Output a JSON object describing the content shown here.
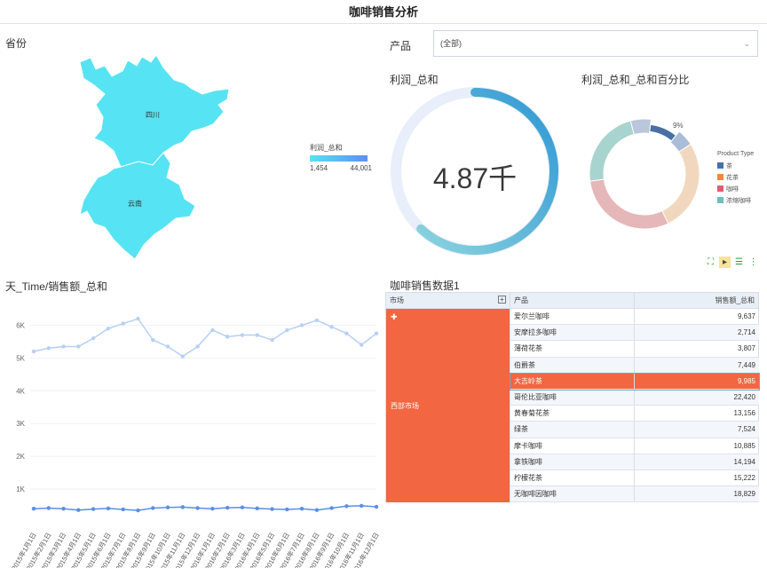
{
  "page": {
    "title": "咖啡销售分析"
  },
  "map": {
    "title": "省份",
    "regions": [
      "四川",
      "云南"
    ],
    "legend_title": "利润_总和",
    "legend_min": "1,454",
    "legend_max": "44,001",
    "colors": {
      "fill": "#56e3f3",
      "low": "#5ae1f2",
      "high": "#5f8ff0"
    }
  },
  "filter": {
    "label": "产品",
    "value": "(全部)"
  },
  "gauge": {
    "title": "利润_总和",
    "value": "4.87千",
    "fraction": 0.62,
    "colors": {
      "track": "#e8eefa",
      "arc_start": "#8bd3df",
      "arc_end": "#2f97d3"
    }
  },
  "donut": {
    "title": "利润_总和_总和百分比",
    "legend_title": "Product Type",
    "label": "9%",
    "items": [
      {
        "name": "茶",
        "color": "#4a6fa5"
      },
      {
        "name": "花茶",
        "color": "#f0883b"
      },
      {
        "name": "咖啡",
        "color": "#e05d6f"
      },
      {
        "name": "浓缩咖啡",
        "color": "#6dbfb7"
      }
    ]
  },
  "toolbar": {
    "icons": [
      "expand-icon",
      "select-icon",
      "list-icon",
      "more-icon"
    ]
  },
  "line_chart": {
    "title": "天_Time/销售额_总和"
  },
  "chart_data": {
    "type": "line",
    "title": "天_Time/销售额_总和",
    "x": [
      "2015年1月1日",
      "2015年2月1日",
      "2015年3月1日",
      "2015年4月1日",
      "2015年5月1日",
      "2015年6月1日",
      "2015年7月1日",
      "2015年8月1日",
      "2015年9月1日",
      "2015年10月1日",
      "2015年11月1日",
      "2015年12月1日",
      "2016年1月1日",
      "2016年2月1日",
      "2016年3月1日",
      "2016年4月1日",
      "2016年5月1日",
      "2016年6月1日",
      "2016年7月1日",
      "2016年8月1日",
      "2016年9月1日",
      "2016年10月1日",
      "2016年11月1日",
      "2016年12月1日"
    ],
    "yticks": [
      "1K",
      "2K",
      "3K",
      "4K",
      "5K",
      "6K"
    ],
    "ylim": [
      0,
      6500
    ],
    "series": [
      {
        "values": [
          5200,
          5300,
          5350,
          5350,
          5600,
          5900,
          6050,
          6200,
          5550,
          5350,
          5050,
          5350,
          5850,
          5650,
          5700,
          5700,
          5550,
          5850,
          6000,
          6150,
          5950,
          5750,
          5400,
          5750
        ],
        "color": "#b8d0f4"
      },
      {
        "values": [
          400,
          420,
          400,
          360,
          390,
          410,
          380,
          350,
          420,
          440,
          450,
          420,
          400,
          430,
          440,
          410,
          390,
          380,
          400,
          360,
          420,
          480,
          490,
          460
        ],
        "color": "#5a8fe8"
      }
    ],
    "grid": true
  },
  "table": {
    "title": "咖啡销售数据1",
    "headers": [
      "市场",
      "产品",
      "销售额_总和"
    ],
    "market": "西部市场",
    "rows": [
      {
        "product": "爱尔兰咖啡",
        "sales": "9,637"
      },
      {
        "product": "安摩拉多咖啡",
        "sales": "2,714"
      },
      {
        "product": "薄荷花茶",
        "sales": "3,807"
      },
      {
        "product": "伯爵茶",
        "sales": "7,449"
      },
      {
        "product": "大吉岭茶",
        "sales": "9,985"
      },
      {
        "product": "哥伦比亚咖啡",
        "sales": "22,420"
      },
      {
        "product": "黄春菊花茶",
        "sales": "13,156"
      },
      {
        "product": "绿茶",
        "sales": "7,524"
      },
      {
        "product": "摩卡咖啡",
        "sales": "10,885"
      },
      {
        "product": "拿铁咖啡",
        "sales": "14,194"
      },
      {
        "product": "柠檬花茶",
        "sales": "15,222"
      },
      {
        "product": "无咖啡因咖啡",
        "sales": "18,829"
      }
    ],
    "highlight_color": "#f26641"
  }
}
